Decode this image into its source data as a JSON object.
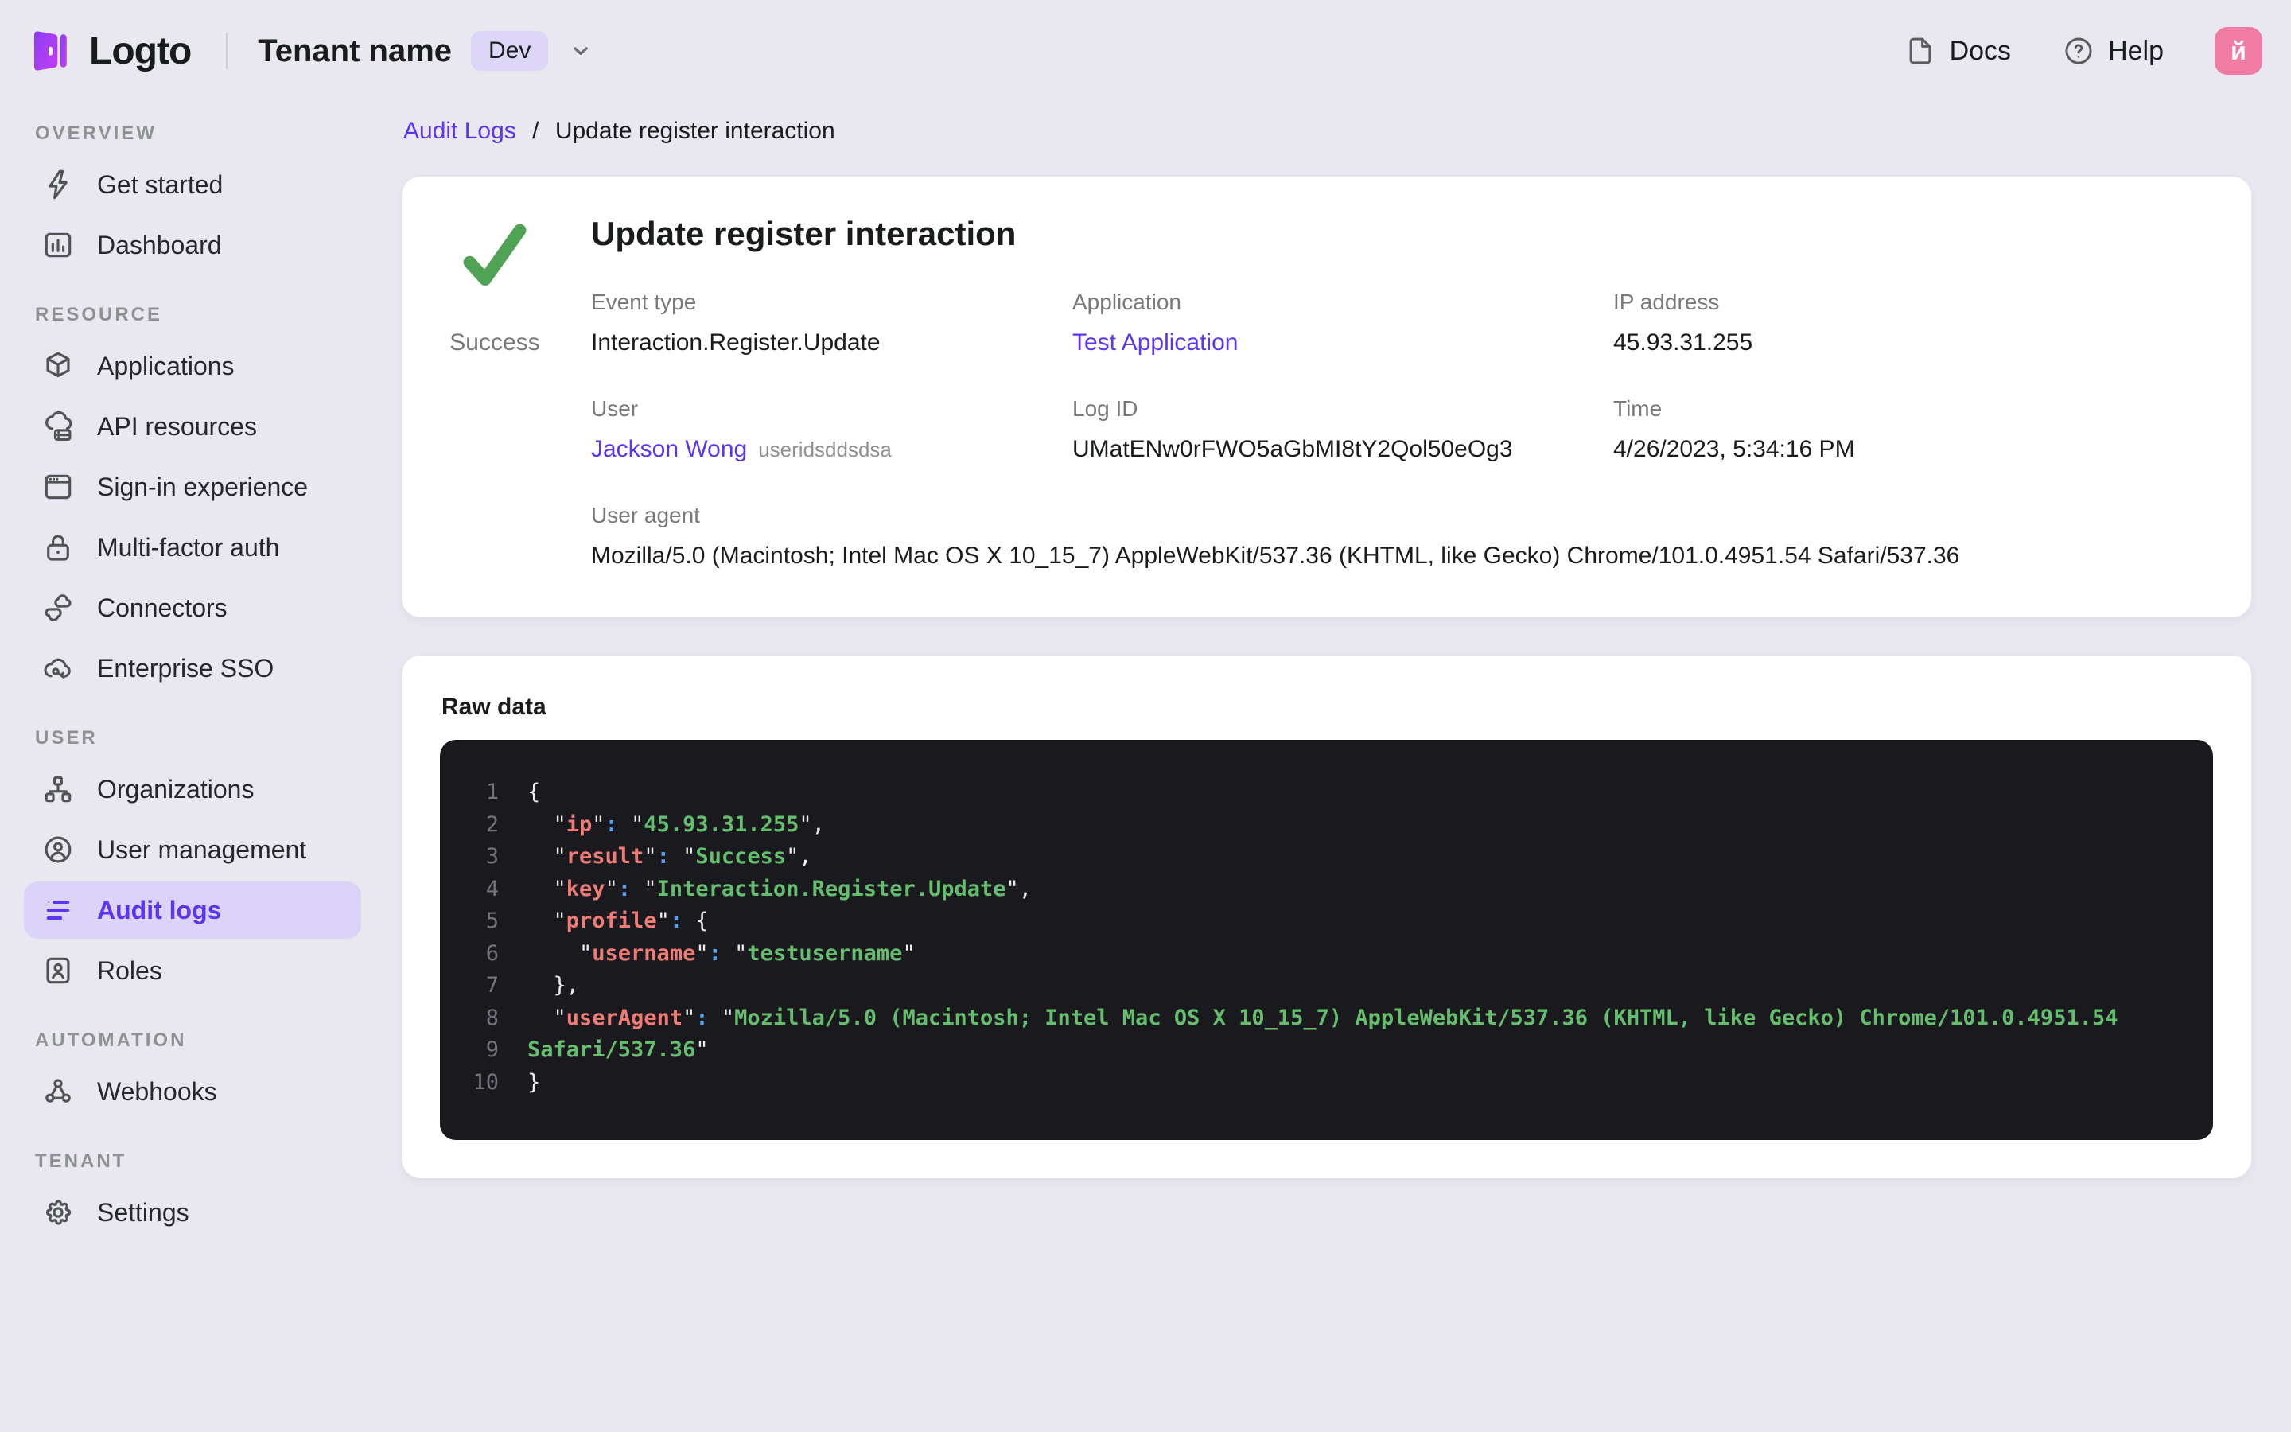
{
  "header": {
    "logo_text": "Logto",
    "tenant_name": "Tenant name",
    "env_badge": "Dev",
    "docs_label": "Docs",
    "help_label": "Help",
    "avatar_text": "й",
    "avatar_color": "#f07ba3"
  },
  "breadcrumb": {
    "parent": "Audit Logs",
    "separator": "/",
    "current": "Update register interaction"
  },
  "sidebar": {
    "sections": [
      {
        "title": "OVERVIEW",
        "items": [
          {
            "label": "Get started",
            "icon": "lightning-icon"
          },
          {
            "label": "Dashboard",
            "icon": "dashboard-icon"
          }
        ]
      },
      {
        "title": "RESOURCE",
        "items": [
          {
            "label": "Applications",
            "icon": "cube-icon"
          },
          {
            "label": "API resources",
            "icon": "cloud-server-icon"
          },
          {
            "label": "Sign-in experience",
            "icon": "browser-icon"
          },
          {
            "label": "Multi-factor auth",
            "icon": "lock-icon"
          },
          {
            "label": "Connectors",
            "icon": "connectors-icon"
          },
          {
            "label": "Enterprise SSO",
            "icon": "cloud-key-icon"
          }
        ]
      },
      {
        "title": "USER",
        "items": [
          {
            "label": "Organizations",
            "icon": "org-tree-icon"
          },
          {
            "label": "User management",
            "icon": "user-circle-icon"
          },
          {
            "label": "Audit logs",
            "icon": "audit-list-icon",
            "active": true
          },
          {
            "label": "Roles",
            "icon": "id-card-icon"
          }
        ]
      },
      {
        "title": "AUTOMATION",
        "items": [
          {
            "label": "Webhooks",
            "icon": "webhook-icon"
          }
        ]
      },
      {
        "title": "TENANT",
        "items": [
          {
            "label": "Settings",
            "icon": "gear-icon"
          }
        ]
      }
    ]
  },
  "detail_card": {
    "status": "Success",
    "status_color": "#50a254",
    "title": "Update register interaction",
    "fields": [
      {
        "label": "Event type",
        "value": "Interaction.Register.Update"
      },
      {
        "label": "Application",
        "value": "Test Application",
        "link": true
      },
      {
        "label": "IP address",
        "value": "45.93.31.255"
      },
      {
        "label": "User",
        "value": "Jackson Wong",
        "link": true,
        "suffix": "useridsddsdsa"
      },
      {
        "label": "Log ID",
        "value": "UMatENw0rFWO5aGbMI8tY2Qol50eOg3"
      },
      {
        "label": "Time",
        "value": "4/26/2023, 5:34:16 PM"
      },
      {
        "label": "User agent",
        "value": "Mozilla/5.0 (Macintosh; Intel Mac OS X 10_15_7) AppleWebKit/537.36 (KHTML, like Gecko) Chrome/101.0.4951.54 Safari/537.36",
        "span": 3
      }
    ]
  },
  "raw_data": {
    "title": "Raw data",
    "colors": {
      "key": "#ee7c76",
      "string": "#65bd6e",
      "colon": "#53a3f6",
      "punctuation": "#ecedee",
      "background": "#1a1a1e",
      "line_number": "#73737e"
    },
    "lines": [
      {
        "num": "1",
        "tokens": [
          [
            "p",
            "{"
          ]
        ]
      },
      {
        "num": "2",
        "tokens": [
          [
            "p",
            "  \""
          ],
          [
            "k",
            "ip"
          ],
          [
            "p",
            "\""
          ],
          [
            "c",
            ":"
          ],
          [
            "p",
            " \""
          ],
          [
            "s",
            "45.93.31.255"
          ],
          [
            "p",
            "\","
          ]
        ]
      },
      {
        "num": "3",
        "tokens": [
          [
            "p",
            "  \""
          ],
          [
            "k",
            "result"
          ],
          [
            "p",
            "\""
          ],
          [
            "c",
            ":"
          ],
          [
            "p",
            " \""
          ],
          [
            "s",
            "Success"
          ],
          [
            "p",
            "\","
          ]
        ]
      },
      {
        "num": "4",
        "tokens": [
          [
            "p",
            "  \""
          ],
          [
            "k",
            "key"
          ],
          [
            "p",
            "\""
          ],
          [
            "c",
            ":"
          ],
          [
            "p",
            " \""
          ],
          [
            "s",
            "Interaction.Register.Update"
          ],
          [
            "p",
            "\","
          ]
        ]
      },
      {
        "num": "5",
        "tokens": [
          [
            "p",
            "  \""
          ],
          [
            "k",
            "profile"
          ],
          [
            "p",
            "\""
          ],
          [
            "c",
            ":"
          ],
          [
            "p",
            " {"
          ]
        ]
      },
      {
        "num": "6",
        "tokens": [
          [
            "p",
            "    \""
          ],
          [
            "k",
            "username"
          ],
          [
            "p",
            "\""
          ],
          [
            "c",
            ":"
          ],
          [
            "p",
            " \""
          ],
          [
            "s",
            "testusername"
          ],
          [
            "p",
            "\""
          ]
        ]
      },
      {
        "num": "7",
        "tokens": [
          [
            "p",
            "  },"
          ]
        ]
      },
      {
        "num": "8",
        "tokens": [
          [
            "p",
            "  \""
          ],
          [
            "k",
            "userAgent"
          ],
          [
            "p",
            "\""
          ],
          [
            "c",
            ":"
          ],
          [
            "p",
            " \""
          ],
          [
            "s",
            "Mozilla/5.0 (Macintosh; Intel Mac OS X 10_15_7) AppleWebKit/537.36 (KHTML, like Gecko) Chrome/101.0.4951.54"
          ]
        ]
      },
      {
        "num": "9",
        "tokens": [
          [
            "s",
            "Safari/537.36"
          ],
          [
            "p",
            "\""
          ]
        ]
      },
      {
        "num": "10",
        "tokens": [
          [
            "p",
            "}"
          ]
        ]
      }
    ]
  },
  "colors": {
    "accent_purple": "#5d34f2",
    "active_pill_bg": "#dcd3f8",
    "page_bg": "#e9e8f1",
    "success_green": "#50a254"
  }
}
